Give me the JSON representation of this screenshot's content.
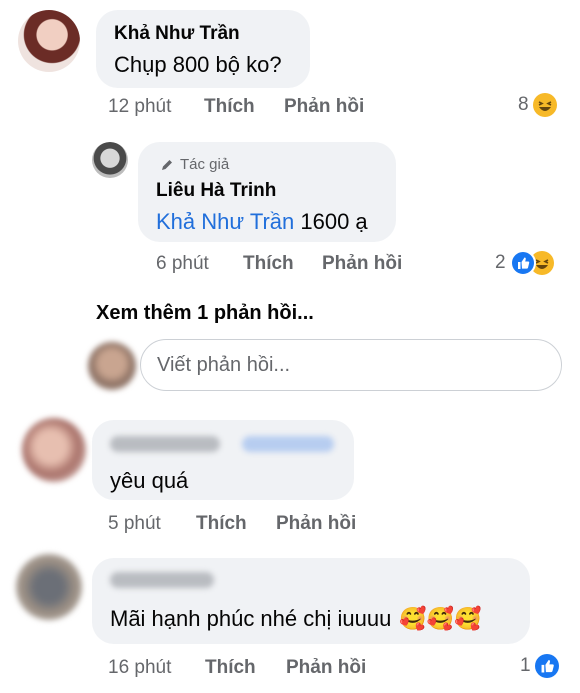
{
  "comments": [
    {
      "author": "Khả Như Trần",
      "text": "Chụp 800 bộ ko?",
      "time": "12 phút",
      "like": "Thích",
      "reply": "Phản hồi",
      "reaction_count": "8",
      "reactions": [
        "haha-icon"
      ]
    },
    {
      "badge": "Tác giả",
      "author": "Liêu Hà Trinh",
      "mention": "Khả Như Trần",
      "text": " 1600 ạ",
      "time": "6 phút",
      "like": "Thích",
      "reply": "Phản hồi",
      "reaction_count": "2",
      "reactions": [
        "like-icon",
        "haha-icon"
      ]
    },
    {
      "text": "yêu quá",
      "time": "5 phút",
      "like": "Thích",
      "reply": "Phản hồi"
    },
    {
      "text": "Mãi hạnh phúc nhé chị iuuuu",
      "emojis": [
        "🥰",
        "🥰",
        "🥰"
      ],
      "time": "16 phút",
      "like": "Thích",
      "reply": "Phản hồi",
      "reaction_count": "1",
      "reactions": [
        "like-icon"
      ]
    }
  ],
  "more_replies": "Xem thêm 1 phản hồi...",
  "reply_input": {
    "placeholder": "Viết phản hồi..."
  },
  "colors": {
    "bubble": "#f0f2f5",
    "meta": "#65676b",
    "link": "#216fdb",
    "like_blue": "#1877f2",
    "haha_yellow": "#f7b928"
  }
}
